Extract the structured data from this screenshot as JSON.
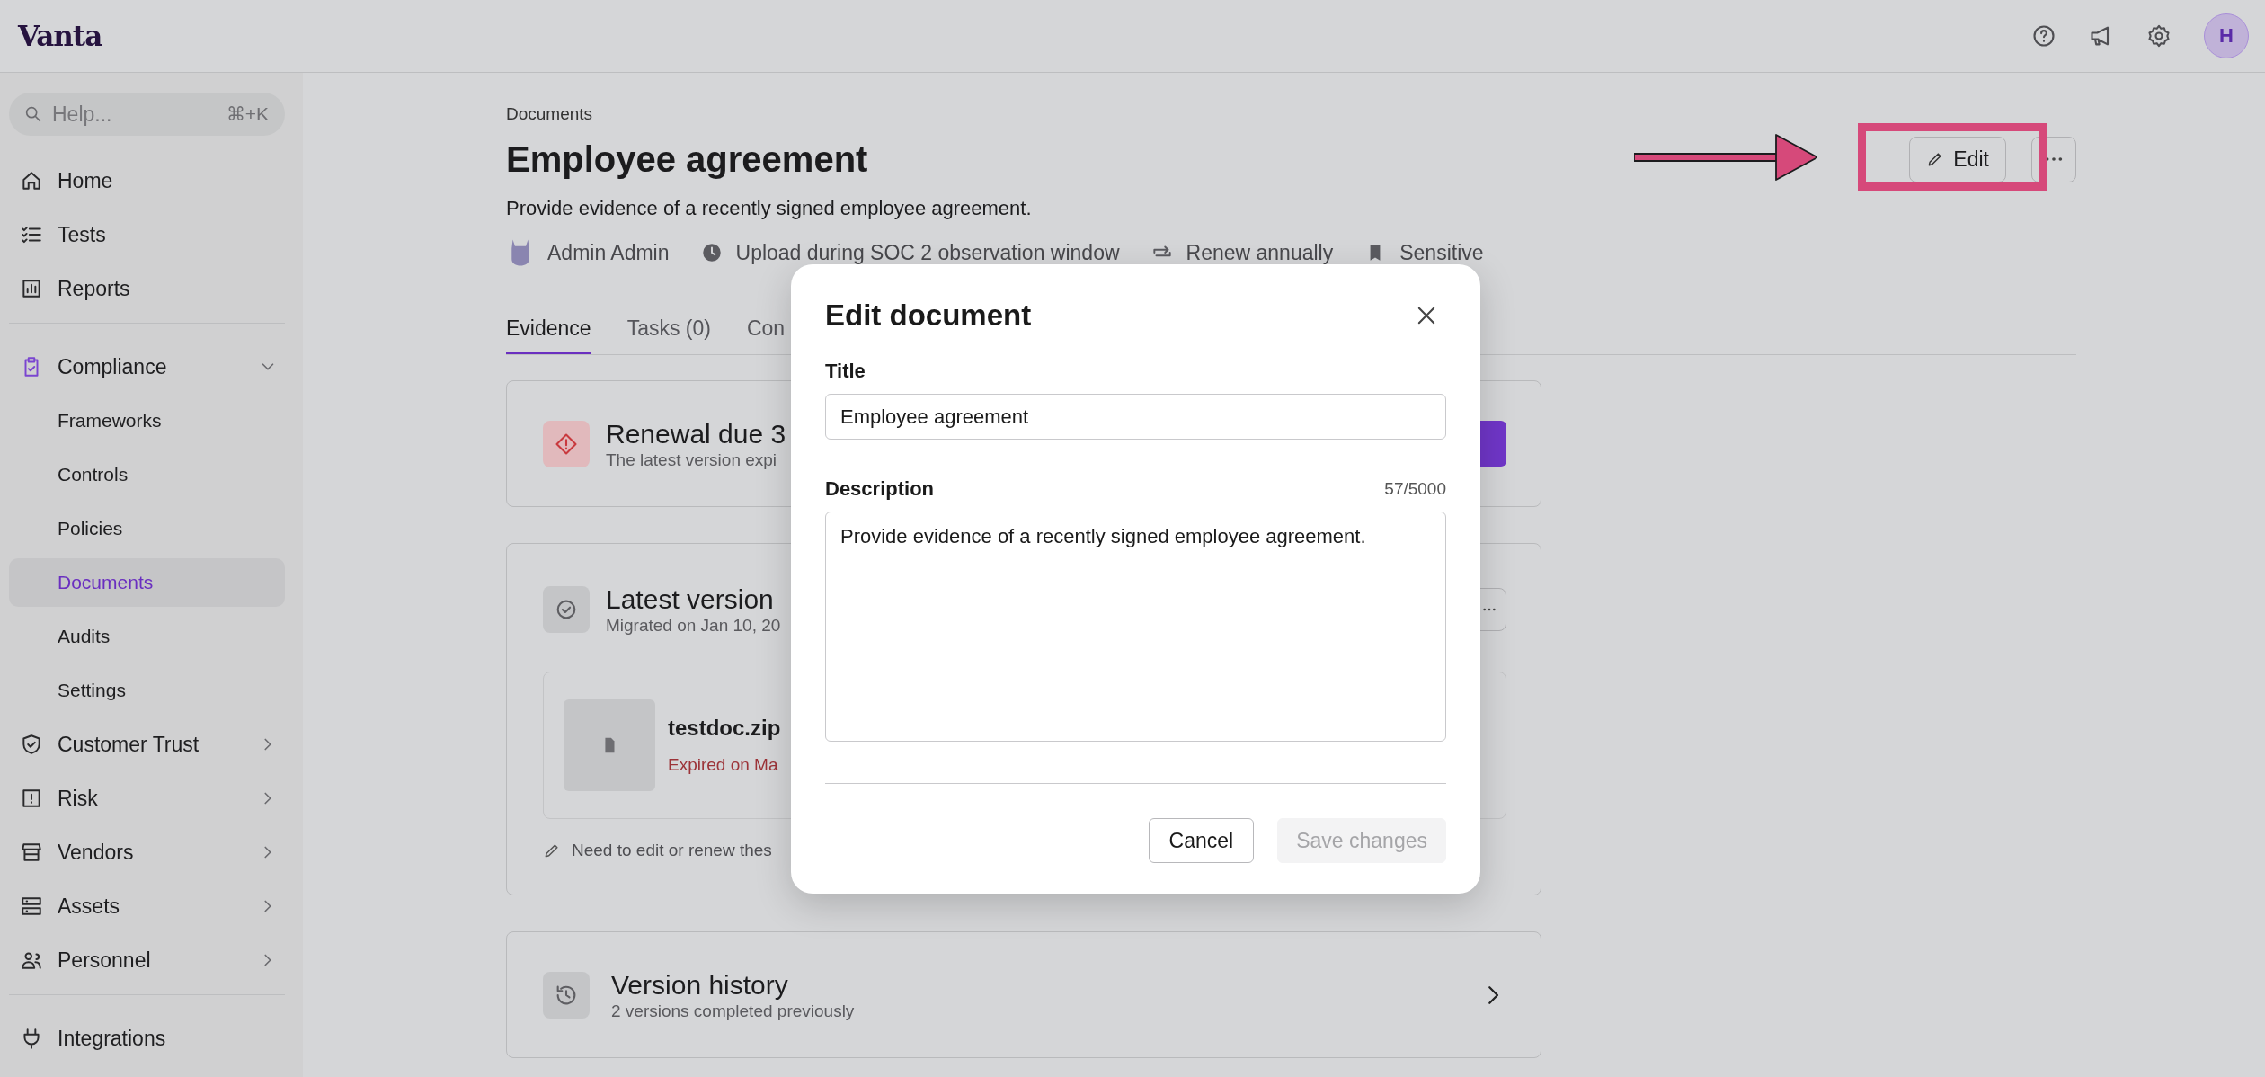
{
  "app": {
    "logo": "Vanta",
    "avatar": "H"
  },
  "sidebar": {
    "search": {
      "placeholder": "Help...",
      "shortcut": "⌘+K"
    },
    "sections": [
      {
        "items": [
          {
            "label": "Home",
            "selected": false
          },
          {
            "label": "Tests",
            "selected": false
          },
          {
            "label": "Reports",
            "selected": false
          }
        ]
      },
      {
        "items": [
          {
            "label": "Compliance",
            "selected": false,
            "expanded": true,
            "children": [
              {
                "label": "Frameworks",
                "selected": false
              },
              {
                "label": "Controls",
                "selected": false
              },
              {
                "label": "Policies",
                "selected": false
              },
              {
                "label": "Documents",
                "selected": true
              },
              {
                "label": "Audits",
                "selected": false
              },
              {
                "label": "Settings",
                "selected": false
              }
            ]
          },
          {
            "label": "Customer Trust",
            "selected": false,
            "expanded": false
          },
          {
            "label": "Risk",
            "selected": false,
            "expanded": false
          },
          {
            "label": "Vendors",
            "selected": false,
            "expanded": false
          },
          {
            "label": "Assets",
            "selected": false,
            "expanded": false
          },
          {
            "label": "Personnel",
            "selected": false,
            "expanded": false
          }
        ]
      },
      {
        "items": [
          {
            "label": "Integrations",
            "selected": false
          }
        ]
      }
    ]
  },
  "page": {
    "breadcrumb": "Documents",
    "title": "Employee agreement",
    "description": "Provide evidence of a recently signed employee agreement.",
    "meta": [
      "Admin Admin",
      "Upload during SOC 2 observation window",
      "Renew annually",
      "Sensitive"
    ],
    "actions": {
      "edit": "Edit"
    },
    "tabs": [
      {
        "label": "Evidence",
        "selected": true
      },
      {
        "label": "Tasks (0)",
        "selected": false
      },
      {
        "label": "Con",
        "selected": false
      }
    ]
  },
  "cards": {
    "renewal": {
      "title": "Renewal due 3",
      "subtitle": "The latest version expi"
    },
    "latest": {
      "title": "Latest version",
      "subtitle": "Migrated on Jan 10, 20",
      "file": {
        "name": "testdoc.zip",
        "status": "Expired on Ma"
      },
      "note": "Need to edit or renew thes"
    },
    "history": {
      "title": "Version history",
      "subtitle": "2 versions completed previously"
    }
  },
  "modal": {
    "title": "Edit document",
    "fields": [
      {
        "kind": "input",
        "label": "Title",
        "value": "Employee agreement"
      },
      {
        "kind": "textarea",
        "label": "Description",
        "counter": "57/5000",
        "value": "Provide evidence of a recently signed employee agreement."
      }
    ],
    "buttons": [
      {
        "label": "Cancel",
        "disabled": false
      },
      {
        "label": "Save changes",
        "disabled": true
      }
    ]
  }
}
